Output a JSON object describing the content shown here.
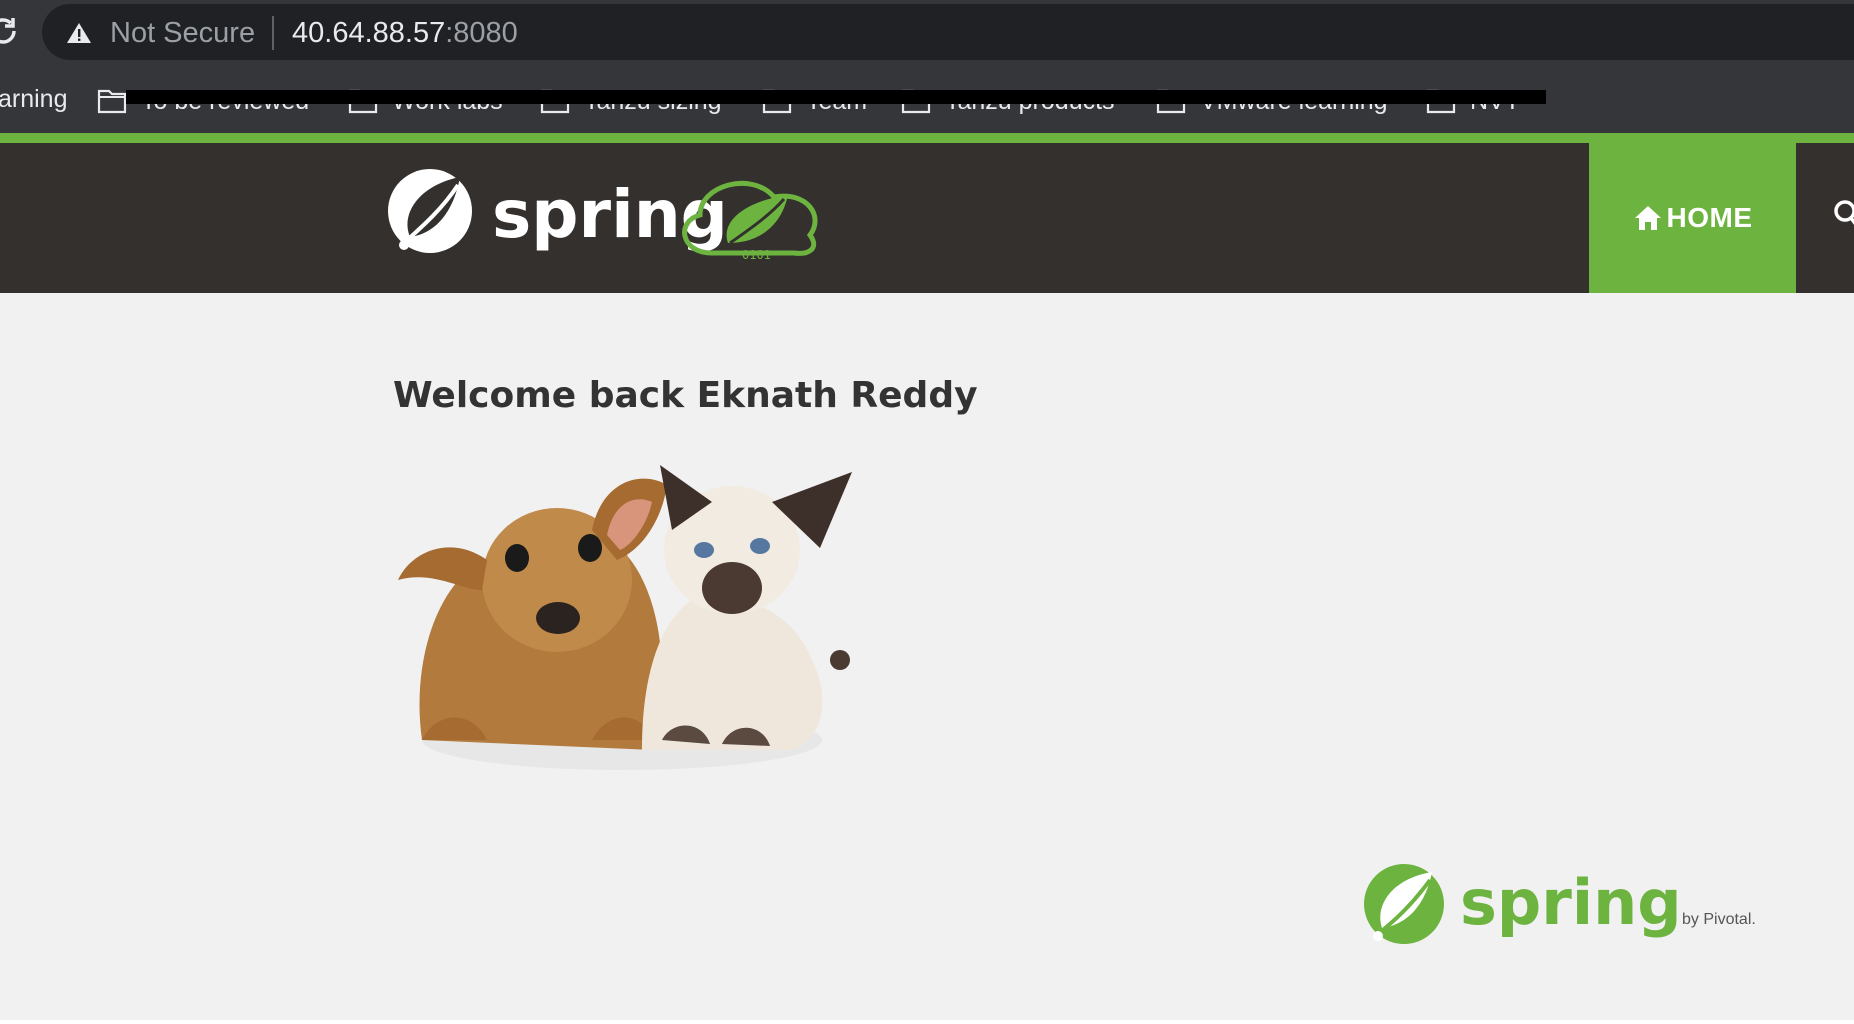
{
  "browser": {
    "security_label": "Not Secure",
    "url_host": "40.64.88.57",
    "url_port": ":8080",
    "bookmarks_partial": "arning",
    "bookmark_folders": [
      {
        "label": "To be reviewed"
      },
      {
        "label": "Work labs"
      },
      {
        "label": "Tanzu sizing"
      },
      {
        "label": "Team"
      },
      {
        "label": "Tanzu products"
      },
      {
        "label": "VMware learning"
      },
      {
        "label": "NVT"
      }
    ]
  },
  "navbar": {
    "logo_text": "spring",
    "home_label": "HOME"
  },
  "main": {
    "welcome": "Welcome back Eknath Reddy"
  },
  "footer": {
    "logo_text": "spring",
    "by_text": "by Pivotal."
  },
  "colors": {
    "brand_green": "#6db33f",
    "navbar_bg": "#34302d",
    "page_bg": "#f1f1f1"
  },
  "icons": {
    "reload": "reload-icon",
    "warning": "warning-icon",
    "folder": "folder-icon",
    "home": "home-icon",
    "search": "search-icon"
  }
}
